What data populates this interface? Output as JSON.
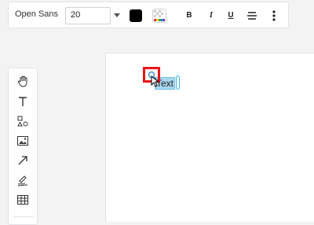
{
  "toolbar": {
    "font_name": "Open Sans",
    "font_size": "20",
    "text_color": "#000000",
    "bold_label": "B",
    "italic_label": "I",
    "underline_label": "U"
  },
  "toolbox": {
    "tools": [
      "hand-icon",
      "text-tool-icon",
      "shapes-icon",
      "image-icon",
      "arrow-icon",
      "pen-icon",
      "table-icon"
    ]
  },
  "canvas": {
    "text_box_value": "Text",
    "selection_color": "#a8d8f0",
    "highlight_color": "#e8141a"
  }
}
